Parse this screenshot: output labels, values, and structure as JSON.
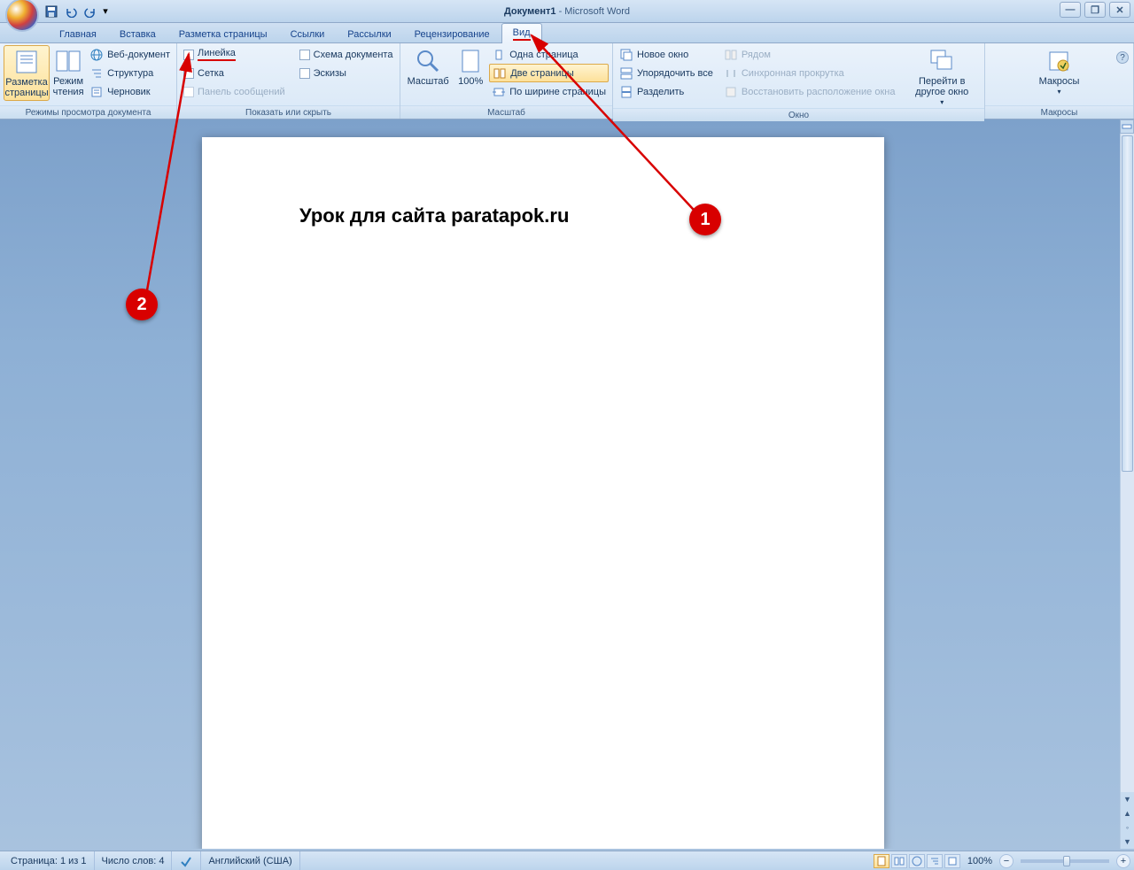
{
  "title": {
    "doc": "Документ1",
    "app": "Microsoft Word"
  },
  "qat": {
    "save": "save-icon",
    "undo": "undo-icon",
    "redo": "redo-icon"
  },
  "tabs": [
    "Главная",
    "Вставка",
    "Разметка страницы",
    "Ссылки",
    "Рассылки",
    "Рецензирование",
    "Вид"
  ],
  "active_tab": "Вид",
  "ribbon": {
    "views": {
      "label": "Режимы просмотра документа",
      "print_layout": "Разметка страницы",
      "reading": "Режим чтения",
      "web": "Веб-документ",
      "outline": "Структура",
      "draft": "Черновик"
    },
    "show_hide": {
      "label": "Показать или скрыть",
      "ruler": "Линейка",
      "gridlines": "Сетка",
      "message_bar": "Панель сообщений",
      "doc_map": "Схема документа",
      "thumbnails": "Эскизы"
    },
    "zoom": {
      "label": "Масштаб",
      "zoom": "Масштаб",
      "hundred": "100%",
      "one_page": "Одна страница",
      "two_pages": "Две страницы",
      "page_width": "По ширине страницы"
    },
    "window": {
      "label": "Окно",
      "new_window": "Новое окно",
      "arrange_all": "Упорядочить все",
      "split": "Разделить",
      "side_by_side": "Рядом",
      "sync_scroll": "Синхронная прокрутка",
      "reset_pos": "Восстановить расположение окна",
      "switch": "Перейти в другое окно"
    },
    "macros": {
      "label": "Макросы",
      "macros": "Макросы"
    }
  },
  "document": {
    "text": "Урок для сайта paratapok.ru"
  },
  "annotations": {
    "c1": "1",
    "c2": "2"
  },
  "statusbar": {
    "page": "Страница: 1 из 1",
    "words": "Число слов: 4",
    "lang": "Английский (США)",
    "zoom": "100%"
  }
}
